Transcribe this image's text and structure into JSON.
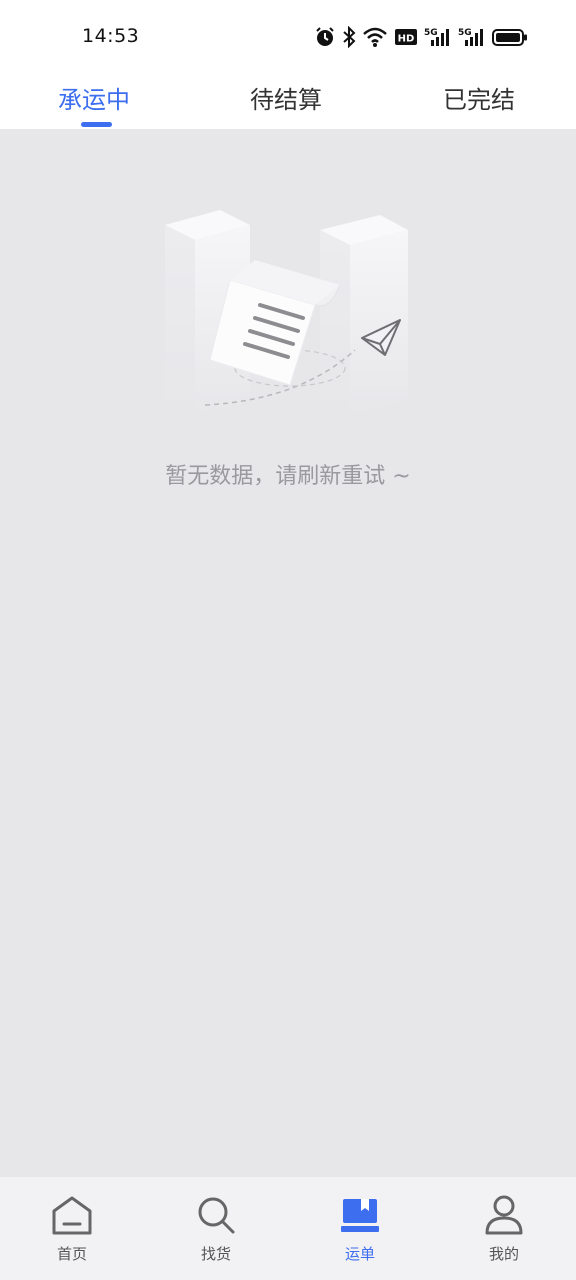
{
  "status_bar": {
    "time": "14:53",
    "icons": [
      "alarm-icon",
      "bluetooth-icon",
      "wifi-icon",
      "hd-icon",
      "signal-5g-icon",
      "signal-5g-icon",
      "battery-icon"
    ],
    "hd_label": "HD",
    "network_label": "5G"
  },
  "tabs": [
    {
      "label": "承运中",
      "active": true
    },
    {
      "label": "待结算",
      "active": false
    },
    {
      "label": "已完结",
      "active": false
    }
  ],
  "empty_state": {
    "message": "暂无数据，请刷新重试 ~",
    "illustration": "empty-document-icon"
  },
  "bottom_nav": [
    {
      "label": "首页",
      "icon": "home-icon",
      "active": false
    },
    {
      "label": "找货",
      "icon": "search-icon",
      "active": false
    },
    {
      "label": "运单",
      "icon": "waybill-icon",
      "active": true
    },
    {
      "label": "我的",
      "icon": "profile-icon",
      "active": false
    }
  ],
  "colors": {
    "accent": "#3d6ef0",
    "background": "#e7e7ea",
    "tab_bar": "#ffffff",
    "nav_bar": "#f2f2f5",
    "muted_text": "#9a9a9e"
  }
}
